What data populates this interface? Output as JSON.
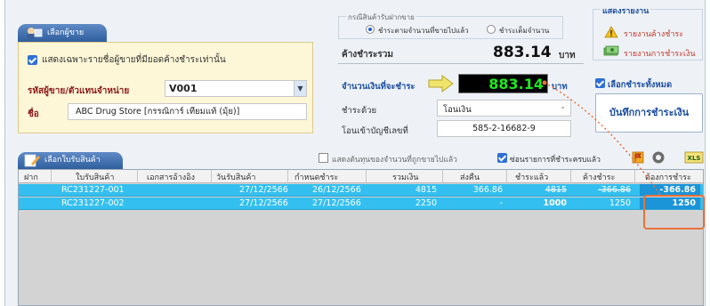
{
  "vendor": {
    "tab_label": "เลือกผู้ขาย",
    "only_due_label": "แสดงเฉพาะรายชื่อผู้ขายที่มียอดค้างชำระเท่านั้น",
    "code_label": "รหัสผู้ขาย/ตัวแทนจำหน่าย",
    "code_value": "V001",
    "name_label": "ชื่อ",
    "name_value": "ABC Drug Store [กรรณิการ์ เทียมแท้ (มุ้ย)]"
  },
  "payment_mode": {
    "legend": "กรณีสินค้ารับฝากขาย",
    "option_sold": "ชำระตามจำนวนที่ขายไปแล้ว",
    "option_full": "ชำระเต็มจำนวน",
    "selected": "option_sold"
  },
  "totals": {
    "outstanding_label": "ค้างชำระรวม",
    "outstanding_value": "883.14",
    "unit": "บาท",
    "pay_label": "จำนวนเงินที่จะชำระ",
    "pay_value": "883.14",
    "pay_unit": "บาท"
  },
  "method": {
    "label": "ชำระด้วย",
    "value": "โอนเงิน",
    "account_label": "โอนเข้าบัญชีเลขที่",
    "account_value": "585-2-16682-9"
  },
  "reports": {
    "title": "แสดงรายงาน",
    "outstanding_report": "รายงานค้างชำระ",
    "payment_report": "รายงานการชำระเงิน"
  },
  "select_all_label": "เลือกชำระทั้งหมด",
  "save_button": "บันทึกการชำระเงิน",
  "receipts": {
    "tab_label": "เลือกใบรับสินค้า",
    "show_remaining_label": "แสดงต้นทุนของจำนวนที่ถูกขายไปแล้ว",
    "hide_paid_label": "ซ่อนรายการที่ชำระครบแล้ว",
    "tool_xls": "XLS",
    "columns": [
      "ฝาก",
      "ใบรับสินค้า",
      "เอกสารอ้างอิง",
      "วันรับสินค้า",
      "กำหนดชำระ",
      "รวมเงิน",
      "ส่งคืน",
      "ชำระแล้ว",
      "ค้างชำระ",
      "ต้องการชำระ"
    ],
    "rows": [
      {
        "deposit": "",
        "receipt": "RC231227-001",
        "ref": "",
        "received": "27/12/2566",
        "due": "26/12/2566",
        "total": "4815",
        "returned": "366.86",
        "paid": "4815",
        "outstanding": "-366.86",
        "to_pay": "-366.86"
      },
      {
        "deposit": "",
        "receipt": "RC231227-002",
        "ref": "",
        "received": "27/12/2566",
        "due": "27/12/2566",
        "total": "2250",
        "returned": "-",
        "paid": "1000",
        "outstanding": "1250",
        "to_pay": "1250"
      }
    ]
  },
  "colors": {
    "accent_blue": "#1d4fa0",
    "row_highlight": "#33bfef",
    "pay_display": "#20e820",
    "callout": "#e8723a"
  }
}
